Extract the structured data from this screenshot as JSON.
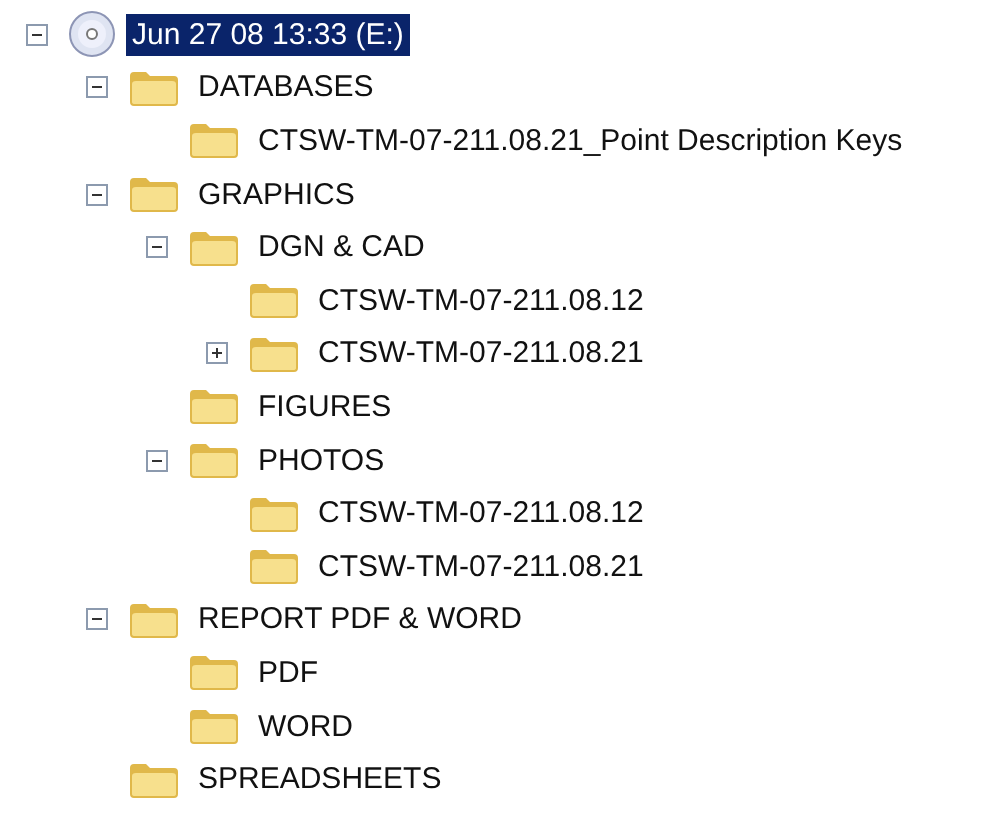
{
  "tree": [
    {
      "label": "Jun 27 08 13:33 (E:)",
      "kind": "drive",
      "selected": true,
      "expanded": true,
      "children": [
        {
          "label": "DATABASES",
          "kind": "folder",
          "selected": false,
          "expanded": true,
          "children": [
            {
              "label": "CTSW-TM-07-211.08.21_Point Description Keys",
              "kind": "folder",
              "selected": false
            }
          ]
        },
        {
          "label": "GRAPHICS",
          "kind": "folder",
          "selected": false,
          "expanded": true,
          "children": [
            {
              "label": "DGN & CAD",
              "kind": "folder",
              "selected": false,
              "expanded": true,
              "children": [
                {
                  "label": "CTSW-TM-07-211.08.12",
                  "kind": "folder",
                  "selected": false
                },
                {
                  "label": "CTSW-TM-07-211.08.21",
                  "kind": "folder",
                  "selected": false,
                  "expanded": false
                }
              ]
            },
            {
              "label": "FIGURES",
              "kind": "folder",
              "selected": false
            },
            {
              "label": "PHOTOS",
              "kind": "folder",
              "selected": false,
              "expanded": true,
              "children": [
                {
                  "label": "CTSW-TM-07-211.08.12",
                  "kind": "folder",
                  "selected": false
                },
                {
                  "label": "CTSW-TM-07-211.08.21",
                  "kind": "folder",
                  "selected": false
                }
              ]
            }
          ]
        },
        {
          "label": "REPORT PDF & WORD",
          "kind": "folder",
          "selected": false,
          "expanded": true,
          "children": [
            {
              "label": "PDF",
              "kind": "folder",
              "selected": false
            },
            {
              "label": "WORD",
              "kind": "folder",
              "selected": false
            }
          ]
        },
        {
          "label": "SPREADSHEETS",
          "kind": "folder",
          "selected": false
        }
      ]
    }
  ]
}
